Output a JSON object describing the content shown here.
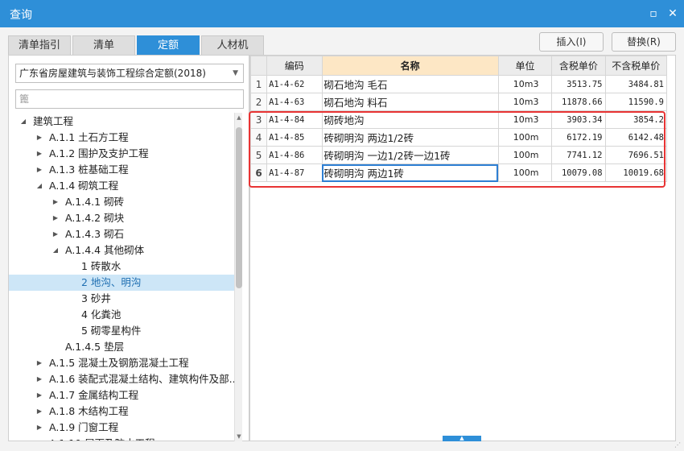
{
  "window": {
    "title": "查询",
    "restore_icon": "restore-icon",
    "close_icon": "close-icon"
  },
  "tabs": [
    {
      "label": "清单指引",
      "active": false
    },
    {
      "label": "清单",
      "active": false
    },
    {
      "label": "定额",
      "active": true
    },
    {
      "label": "人材机",
      "active": false
    }
  ],
  "actions": {
    "insert_label": "插入(I)",
    "replace_label": "替换(R)"
  },
  "left": {
    "quota_library": "广东省房屋建筑与装饰工程综合定额(2018)",
    "filter_value": "篦",
    "tree": [
      {
        "label": "建筑工程",
        "level": 0,
        "toggle": "expanded"
      },
      {
        "label": "A.1.1 土石方工程",
        "level": 1,
        "toggle": "collapsed"
      },
      {
        "label": "A.1.2 围护及支护工程",
        "level": 1,
        "toggle": "collapsed"
      },
      {
        "label": "A.1.3 桩基础工程",
        "level": 1,
        "toggle": "collapsed"
      },
      {
        "label": "A.1.4 砌筑工程",
        "level": 1,
        "toggle": "expanded"
      },
      {
        "label": "A.1.4.1 砌砖",
        "level": 2,
        "toggle": "collapsed"
      },
      {
        "label": "A.1.4.2 砌块",
        "level": 2,
        "toggle": "collapsed"
      },
      {
        "label": "A.1.4.3 砌石",
        "level": 2,
        "toggle": "collapsed"
      },
      {
        "label": "A.1.4.4 其他砌体",
        "level": 2,
        "toggle": "expanded"
      },
      {
        "label": "1 砖散水",
        "level": 3,
        "toggle": "none"
      },
      {
        "label": "2 地沟、明沟",
        "level": 3,
        "toggle": "none",
        "selected": true
      },
      {
        "label": "3 砂井",
        "level": 3,
        "toggle": "none"
      },
      {
        "label": "4 化粪池",
        "level": 3,
        "toggle": "none"
      },
      {
        "label": "5 砌零星构件",
        "level": 3,
        "toggle": "none"
      },
      {
        "label": "A.1.4.5 垫层",
        "level": 2,
        "toggle": "none"
      },
      {
        "label": "A.1.5 混凝土及钢筋混凝土工程",
        "level": 1,
        "toggle": "collapsed"
      },
      {
        "label": "A.1.6 装配式混凝土结构、建筑构件及部...",
        "level": 1,
        "toggle": "collapsed"
      },
      {
        "label": "A.1.7 金属结构工程",
        "level": 1,
        "toggle": "collapsed"
      },
      {
        "label": "A.1.8 木结构工程",
        "level": 1,
        "toggle": "collapsed"
      },
      {
        "label": "A.1.9 门窗工程",
        "level": 1,
        "toggle": "collapsed"
      },
      {
        "label": "A.1.10 屋面及防水工程",
        "level": 1,
        "toggle": "collapsed"
      }
    ]
  },
  "grid": {
    "columns": [
      "",
      "编码",
      "名称",
      "单位",
      "含税单价",
      "不含税单价"
    ],
    "rows": [
      {
        "no": "1",
        "code": "A1-4-62",
        "name": "砌石地沟 毛石",
        "unit": "10m3",
        "price_tax": "3513.75",
        "price_notax": "3484.81"
      },
      {
        "no": "2",
        "code": "A1-4-63",
        "name": "砌石地沟 料石",
        "unit": "10m3",
        "price_tax": "11878.66",
        "price_notax": "11590.9"
      },
      {
        "no": "3",
        "code": "A1-4-84",
        "name": "砌砖地沟",
        "unit": "10m3",
        "price_tax": "3903.34",
        "price_notax": "3854.2"
      },
      {
        "no": "4",
        "code": "A1-4-85",
        "name": "砖砌明沟 两边1/2砖",
        "unit": "100m",
        "price_tax": "6172.19",
        "price_notax": "6142.48"
      },
      {
        "no": "5",
        "code": "A1-4-86",
        "name": "砖砌明沟 一边1/2砖一边1砖",
        "unit": "100m",
        "price_tax": "7741.12",
        "price_notax": "7696.51"
      },
      {
        "no": "6",
        "code": "A1-4-87",
        "name": "砖砌明沟 两边1砖",
        "unit": "100m",
        "price_tax": "10079.08",
        "price_notax": "10019.68"
      }
    ]
  },
  "colors": {
    "accent": "#2e8fd8",
    "highlight_border": "#e83434",
    "name_header": "#fde7c5",
    "selection": "#cde6f7"
  }
}
